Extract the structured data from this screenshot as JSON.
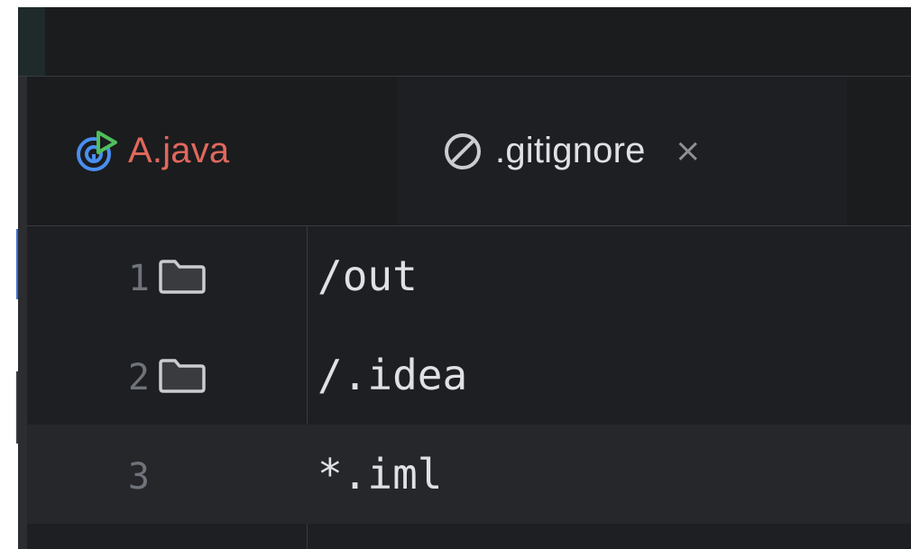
{
  "tabs": [
    {
      "label": "A.java",
      "icon": "java-class-run-icon",
      "color": "#e0685c",
      "active": false
    },
    {
      "label": ".gitignore",
      "icon": "ignore-file-icon",
      "color": "#dfe1e5",
      "active": true
    }
  ],
  "editor": {
    "lines": [
      {
        "number": "1",
        "text": "/out",
        "gutter_icon": "folder-icon"
      },
      {
        "number": "2",
        "text": "/.idea",
        "gutter_icon": "folder-icon"
      },
      {
        "number": "3",
        "text": "*.iml",
        "gutter_icon": ""
      }
    ]
  },
  "colors": {
    "background": "#1e1f22",
    "accent": "#2a6db0",
    "modified_tab_text": "#e0685c"
  }
}
